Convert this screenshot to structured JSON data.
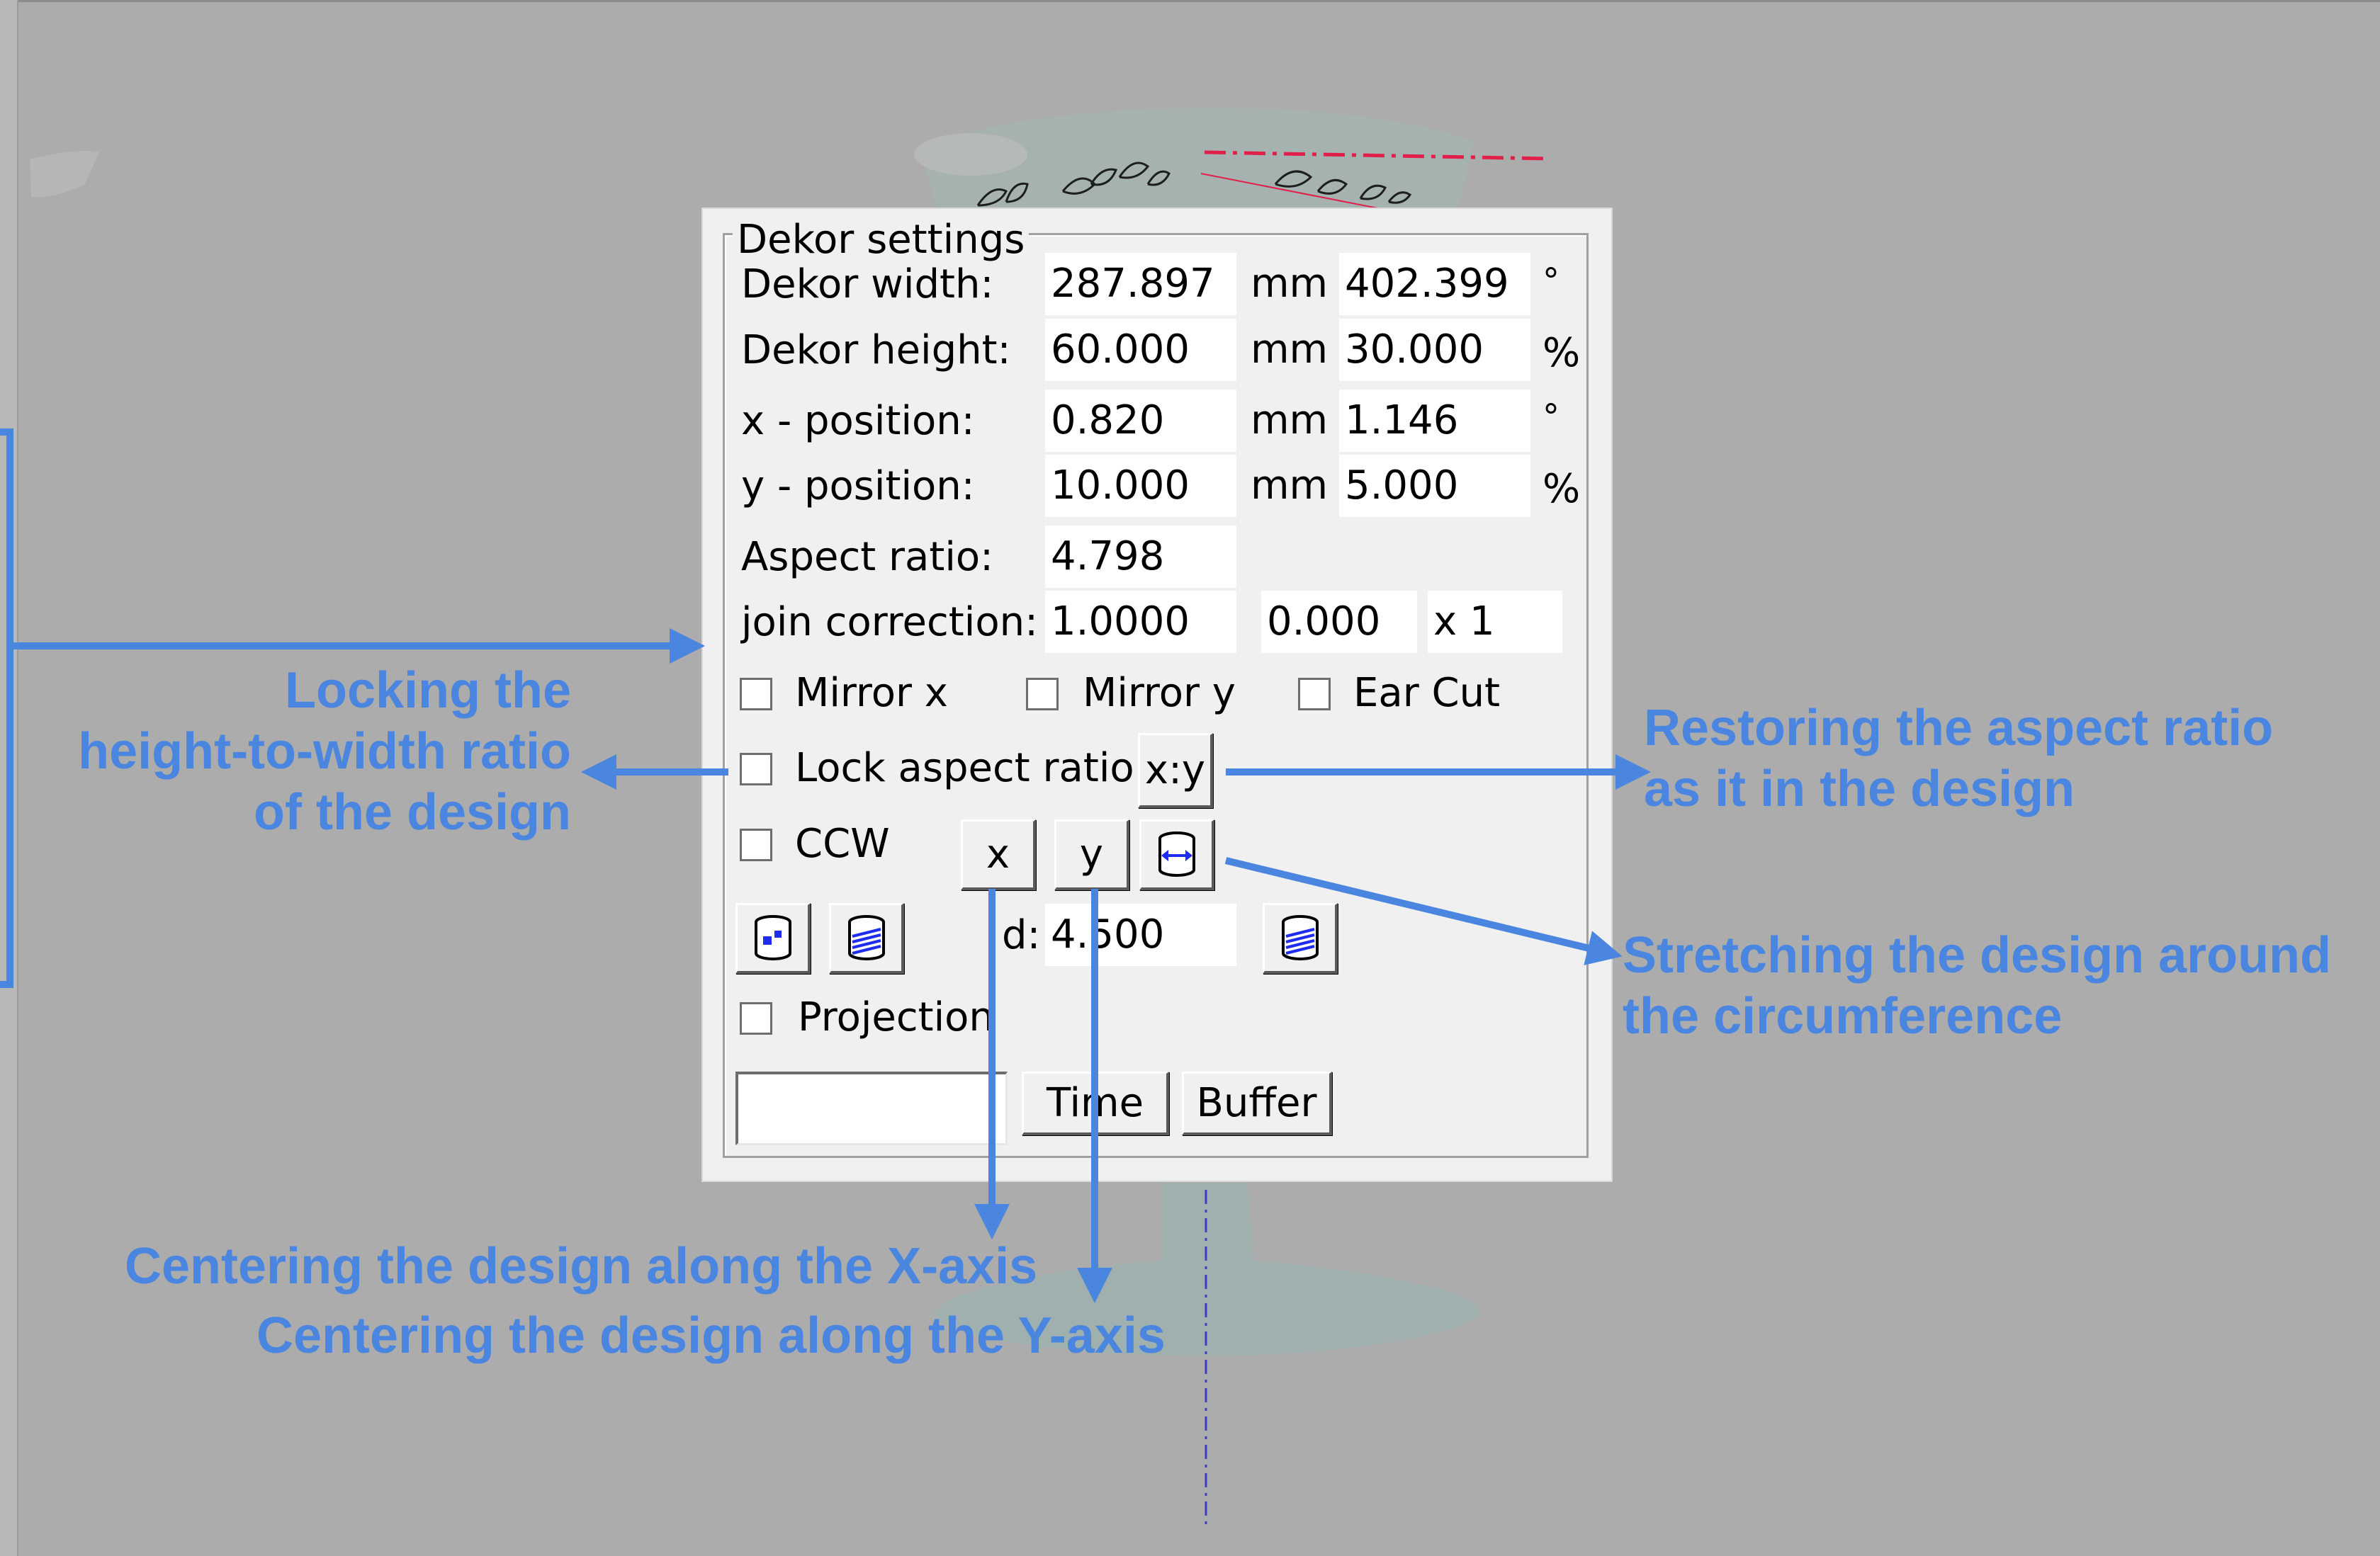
{
  "panel": {
    "title": "Dekor settings",
    "rows": [
      {
        "label": "Dekor width:",
        "value": "287.897",
        "unit": "mm",
        "value2": "402.399",
        "unit2": "°"
      },
      {
        "label": "Dekor height:",
        "value": "60.000",
        "unit": "mm",
        "value2": "30.000",
        "unit2": "%"
      },
      {
        "label": "x - position:",
        "value": "0.820",
        "unit": "mm",
        "value2": "1.146",
        "unit2": "°"
      },
      {
        "label": "y - position:",
        "value": "10.000",
        "unit": "mm",
        "value2": "5.000",
        "unit2": "%"
      }
    ],
    "aspect_ratio": {
      "label": "Aspect ratio:",
      "value": "4.798"
    },
    "join_correction": {
      "label": "join correction:",
      "value": "1.0000",
      "value2": "0.000",
      "value3": "x 1"
    },
    "checkboxes": {
      "mirror_x": "Mirror x",
      "mirror_y": "Mirror y",
      "ear_cut": "Ear Cut",
      "lock_aspect": "Lock aspect ratio",
      "ccw": "CCW",
      "projection": "Projection"
    },
    "buttons": {
      "xy": "x:y",
      "x": "x",
      "y": "y",
      "time": "Time",
      "buffer": "Buffer"
    },
    "diameter": {
      "label": "d:",
      "value": "4.500"
    },
    "bottom_field": ""
  },
  "icons": [
    "cylinder-stretch-icon",
    "cylinder-point-icon",
    "cylinder-hatch-icon",
    "cylinder-hatch-icon-2"
  ],
  "annotations": {
    "lock": [
      "Locking the",
      "height-to-width ratio",
      "of the design"
    ],
    "restore": [
      "Restoring the aspect ratio",
      "as it in the design"
    ],
    "stretch": [
      "Stretching the design around",
      "the circumference"
    ],
    "center_x": "Centering the design along the X-axis",
    "center_y": "Centering the design along the Y-axis"
  },
  "colors": {
    "annotation": "#4a86e0",
    "background": "#acacac",
    "panel": "#f0f0f0"
  }
}
